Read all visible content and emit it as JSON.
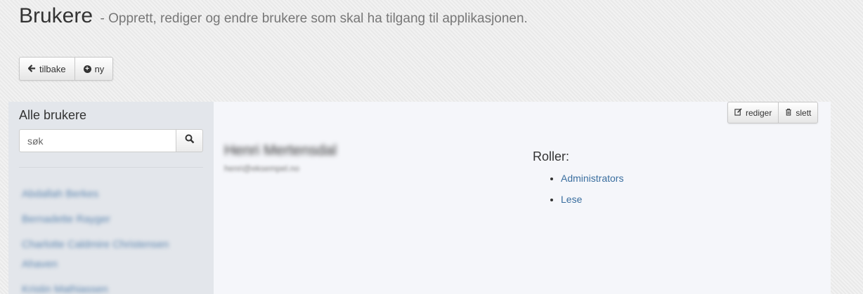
{
  "header": {
    "title": "Brukere",
    "subtitle": "- Opprett, rediger og endre brukere som skal ha tilgang til applikasjonen."
  },
  "toolbar": {
    "back_label": "tilbake",
    "new_label": "ny"
  },
  "sidebar": {
    "title": "Alle brukere",
    "search_placeholder": "søk",
    "users": [
      "Abdallah Berkes",
      "Bernadette Rayger",
      "Charlotte Caldmire Christensen Ahaven",
      "Kristin Mathiassen"
    ]
  },
  "detail": {
    "edit_label": "rediger",
    "delete_label": "slett",
    "user_name": "Henri Mertensdal",
    "user_email": "henri@eksempel.no",
    "roles_title": "Roller:",
    "roles": [
      "Administrators",
      "Lese"
    ]
  },
  "icons": {
    "back": "arrow-left-icon",
    "new": "plus-circle-icon",
    "search": "search-icon",
    "edit": "edit-icon",
    "delete": "trash-icon"
  },
  "colors": {
    "link": "#3a6e9f",
    "sidebar_bg": "#e3e6eb",
    "panel_bg": "#f5f6fa"
  }
}
